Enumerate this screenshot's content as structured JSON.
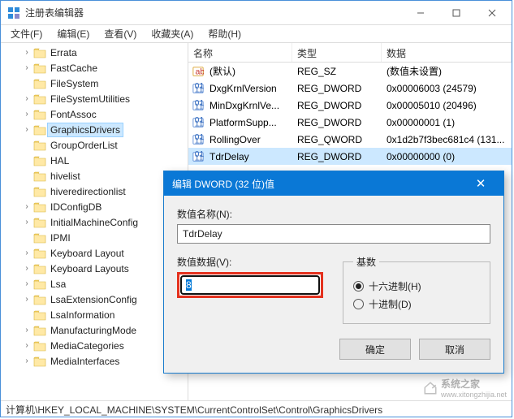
{
  "app": {
    "title": "注册表编辑器"
  },
  "menu": {
    "file": "文件(F)",
    "edit": "编辑(E)",
    "view": "查看(V)",
    "favorites": "收藏夹(A)",
    "help": "帮助(H)"
  },
  "tree": {
    "items": [
      {
        "label": "Errata",
        "expandable": true
      },
      {
        "label": "FastCache",
        "expandable": true
      },
      {
        "label": "FileSystem",
        "expandable": false
      },
      {
        "label": "FileSystemUtilities",
        "expandable": true
      },
      {
        "label": "FontAssoc",
        "expandable": true
      },
      {
        "label": "GraphicsDrivers",
        "expandable": true,
        "selected": true
      },
      {
        "label": "GroupOrderList",
        "expandable": false
      },
      {
        "label": "HAL",
        "expandable": false
      },
      {
        "label": "hivelist",
        "expandable": false
      },
      {
        "label": "hiveredirectionlist",
        "expandable": false
      },
      {
        "label": "IDConfigDB",
        "expandable": true
      },
      {
        "label": "InitialMachineConfig",
        "expandable": true
      },
      {
        "label": "IPMI",
        "expandable": false
      },
      {
        "label": "Keyboard Layout",
        "expandable": true
      },
      {
        "label": "Keyboard Layouts",
        "expandable": true
      },
      {
        "label": "Lsa",
        "expandable": true
      },
      {
        "label": "LsaExtensionConfig",
        "expandable": true
      },
      {
        "label": "LsaInformation",
        "expandable": false
      },
      {
        "label": "ManufacturingMode",
        "expandable": true
      },
      {
        "label": "MediaCategories",
        "expandable": true
      },
      {
        "label": "MediaInterfaces",
        "expandable": true
      }
    ]
  },
  "list": {
    "columns": {
      "name": "名称",
      "type": "类型",
      "data": "数据"
    },
    "rows": [
      {
        "icon": "string",
        "name": "(默认)",
        "type": "REG_SZ",
        "data": "(数值未设置)"
      },
      {
        "icon": "binary",
        "name": "DxgKrnlVersion",
        "type": "REG_DWORD",
        "data": "0x00006003 (24579)"
      },
      {
        "icon": "binary",
        "name": "MinDxgKrnlVe...",
        "type": "REG_DWORD",
        "data": "0x00005010 (20496)"
      },
      {
        "icon": "binary",
        "name": "PlatformSupp...",
        "type": "REG_DWORD",
        "data": "0x00000001 (1)"
      },
      {
        "icon": "binary",
        "name": "RollingOver",
        "type": "REG_QWORD",
        "data": "0x1d2b7f3bec681c4 (131..."
      },
      {
        "icon": "binary",
        "name": "TdrDelay",
        "type": "REG_DWORD",
        "data": "0x00000000 (0)",
        "selected": true
      }
    ]
  },
  "status": {
    "path": "计算机\\HKEY_LOCAL_MACHINE\\SYSTEM\\CurrentControlSet\\Control\\GraphicsDrivers"
  },
  "dialog": {
    "title": "编辑 DWORD (32 位)值",
    "name_label": "数值名称(N):",
    "name_value": "TdrDelay",
    "data_label": "数值数据(V):",
    "data_value": "8",
    "base_label": "基数",
    "radio_hex": "十六进制(H)",
    "radio_dec": "十进制(D)",
    "ok": "确定",
    "cancel": "取消"
  },
  "watermark": {
    "text": "系统之家",
    "url": "www.xitongzhijia.net"
  }
}
